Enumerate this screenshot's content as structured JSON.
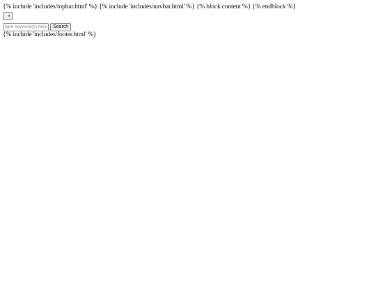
{
  "header": {
    "template_text": "{% include 'includes/topbar.html' %} {% include 'includes/navbar.html' %} {% block content %} {% endblock %}"
  },
  "close_button": {
    "label": "×"
  },
  "search": {
    "placeholder": "type keyword(s) here. E",
    "value": "",
    "button_label": "Search"
  },
  "footer": {
    "template_text": "{% include 'includes/footer.html' %}"
  }
}
